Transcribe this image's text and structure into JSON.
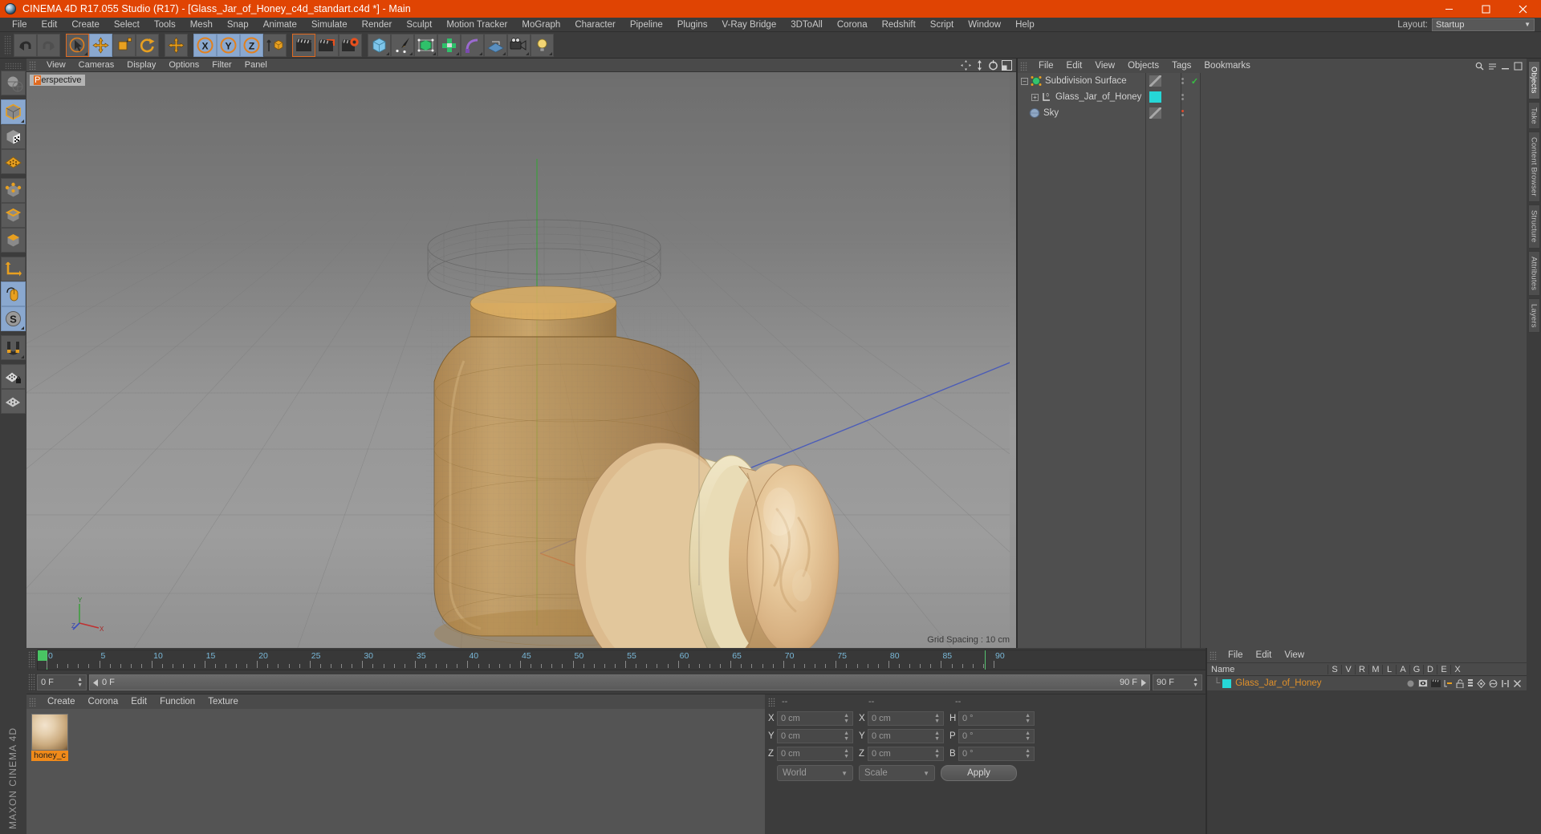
{
  "window": {
    "title": "CINEMA 4D R17.055 Studio (R17) - [Glass_Jar_of_Honey_c4d_standart.c4d *] - Main",
    "minimize": "minimize-icon",
    "maximize": "maximize-icon",
    "close": "close-icon",
    "accent_color": "#e04403"
  },
  "menubar": {
    "items": [
      "File",
      "Edit",
      "Create",
      "Select",
      "Tools",
      "Mesh",
      "Snap",
      "Animate",
      "Simulate",
      "Render",
      "Sculpt",
      "Motion Tracker",
      "MoGraph",
      "Character",
      "Pipeline",
      "Plugins",
      "V-Ray Bridge",
      "3DToAll",
      "Corona",
      "Redshift",
      "Script",
      "Window",
      "Help"
    ],
    "layout_label": "Layout:",
    "layout_value": "Startup"
  },
  "toolbar": {
    "groups": [
      {
        "name": "history",
        "buttons": [
          {
            "name": "undo-button",
            "icon": "undo-arrow-icon",
            "state": "normal"
          },
          {
            "name": "redo-button",
            "icon": "redo-arrow-icon",
            "state": "disabled"
          }
        ]
      },
      {
        "name": "transform",
        "buttons": [
          {
            "name": "live-selection-button",
            "icon": "cursor-circle-icon",
            "state": "highlight"
          },
          {
            "name": "move-button",
            "icon": "move-arrows-icon",
            "state": "active"
          },
          {
            "name": "scale-button",
            "icon": "scale-box-icon",
            "state": "normal"
          },
          {
            "name": "rotate-button",
            "icon": "rotate-circle-icon",
            "state": "normal"
          }
        ]
      },
      {
        "name": "axis",
        "buttons": [
          {
            "name": "world-object-axis-button",
            "icon": "move-arrows-icon",
            "state": "normal"
          }
        ]
      },
      {
        "name": "lock-axes",
        "buttons": [
          {
            "name": "lock-x-button",
            "icon": "x-axis-icon",
            "state": "active",
            "label": "X"
          },
          {
            "name": "lock-y-button",
            "icon": "y-axis-icon",
            "state": "active",
            "label": "Y"
          },
          {
            "name": "lock-z-button",
            "icon": "z-axis-icon",
            "state": "active",
            "label": "Z"
          },
          {
            "name": "coordinate-system-button",
            "icon": "world-coordinate-icon",
            "state": "normal"
          }
        ]
      },
      {
        "name": "render",
        "buttons": [
          {
            "name": "render-view-button",
            "icon": "clapper-icon",
            "state": "highlight"
          },
          {
            "name": "render-region-button",
            "icon": "clapper-region-icon",
            "state": "normal"
          },
          {
            "name": "render-settings-button",
            "icon": "clapper-gear-icon",
            "state": "normal"
          }
        ]
      },
      {
        "name": "create",
        "buttons": [
          {
            "name": "add-cube-button",
            "icon": "cube-icon",
            "state": "normal"
          },
          {
            "name": "add-spline-button",
            "icon": "pen-icon",
            "state": "normal"
          },
          {
            "name": "nurbs-button",
            "icon": "subdivision-cube-icon",
            "state": "normal"
          },
          {
            "name": "array-button",
            "icon": "array-icon",
            "state": "normal"
          },
          {
            "name": "deformer-button",
            "icon": "bend-deformer-icon",
            "state": "normal"
          },
          {
            "name": "scene-button",
            "icon": "floor-scene-icon",
            "state": "normal"
          },
          {
            "name": "camera-button",
            "icon": "camera-icon",
            "state": "normal"
          },
          {
            "name": "light-button",
            "icon": "light-bulb-icon",
            "state": "normal"
          }
        ]
      }
    ]
  },
  "left_palette": {
    "buttons": [
      {
        "name": "texture-axis-button",
        "icon": "globe-texture-icon",
        "state": "normal"
      },
      {
        "name": "model-mode-button",
        "icon": "model-cube-icon",
        "state": "active"
      },
      {
        "name": "texture-mode-button",
        "icon": "texture-cube-icon",
        "state": "normal"
      },
      {
        "name": "workplane-button",
        "icon": "grid-plane-icon",
        "state": "normal"
      },
      {
        "name": "points-mode-button",
        "icon": "points-cube-icon",
        "state": "normal"
      },
      {
        "name": "edges-mode-button",
        "icon": "edges-cube-icon",
        "state": "normal"
      },
      {
        "name": "polygons-mode-button",
        "icon": "polygons-cube-icon",
        "state": "normal"
      },
      {
        "name": "object-axis-button",
        "icon": "axis-corner-icon",
        "state": "normal"
      },
      {
        "name": "enable-axis-button",
        "icon": "mouse-icon",
        "state": "active"
      },
      {
        "name": "soft-selection-button",
        "icon": "s-circle-icon",
        "state": "active"
      },
      {
        "name": "snap-magnet-button",
        "icon": "magnet-icon",
        "state": "normal"
      },
      {
        "name": "lock-workplane-button",
        "icon": "grid-lock-icon",
        "state": "normal"
      },
      {
        "name": "workplane-mode-button",
        "icon": "grid-mode-icon",
        "state": "normal"
      }
    ]
  },
  "viewport": {
    "menu": [
      "View",
      "Cameras",
      "Display",
      "Options",
      "Filter",
      "Panel"
    ],
    "label_prefix": "P",
    "label_rest": "erspective",
    "grid_spacing": "Grid Spacing : 10 cm",
    "axis_labels": {
      "y": "Y",
      "z": "Z",
      "x": "X"
    },
    "nav_icons": [
      "pan-icon",
      "dolly-icon",
      "rotate-icon",
      "maximize-view-icon"
    ]
  },
  "object_manager": {
    "menu": [
      "File",
      "Edit",
      "View",
      "Objects",
      "Tags",
      "Bookmarks"
    ],
    "right_icons": [
      "search-icon",
      "options-icon",
      "minimize-icon",
      "maximize-icon"
    ],
    "objects": [
      {
        "name": "Subdivision Surface",
        "icon": "subdivision-surface-icon",
        "indent": 0,
        "expander": "-",
        "tag": "none",
        "dots": 2,
        "check": true
      },
      {
        "name": "Glass_Jar_of_Honey",
        "icon": "null-object-icon",
        "indent": 1,
        "expander": "+",
        "tag": "cyan",
        "dots": 2,
        "check": false
      },
      {
        "name": "Sky",
        "icon": "sky-icon",
        "indent": 0,
        "expander": "",
        "tag": "none",
        "dots": 2,
        "check": false,
        "red_dot": true
      }
    ]
  },
  "right_tabs": [
    {
      "label": "Objects",
      "selected": true
    },
    {
      "label": "Take"
    },
    {
      "label": "Content Browser"
    },
    {
      "label": "Structure"
    },
    {
      "label": "Attributes"
    },
    {
      "label": "Layers"
    }
  ],
  "timeline": {
    "ticks": [
      0,
      5,
      10,
      15,
      20,
      25,
      30,
      35,
      40,
      45,
      50,
      55,
      60,
      65,
      70,
      75,
      80,
      85,
      90
    ],
    "current_frame": "0 F",
    "end_field": "0 F",
    "playhead_frame": 0
  },
  "transport": {
    "start_field": "0 F",
    "range_start": "0 F",
    "range_end": "90 F",
    "end_field": "90 F",
    "buttons": [
      {
        "name": "go-to-start-button",
        "icon": "skip-start-icon",
        "state": "normal"
      },
      {
        "name": "loop-button",
        "icon": "loop-icon",
        "state": "normal"
      },
      {
        "name": "step-back-button",
        "icon": "step-back-icon",
        "state": "normal"
      },
      {
        "name": "play-button",
        "icon": "play-icon",
        "state": "normal"
      },
      {
        "name": "step-forward-button",
        "icon": "step-forward-icon",
        "state": "normal"
      },
      {
        "name": "go-to-end-button",
        "icon": "skip-end-icon",
        "state": "normal"
      },
      {
        "name": "record-active-button",
        "icon": "record-objects-icon",
        "state": "normal"
      },
      {
        "name": "autokey-button",
        "icon": "autokey-icon",
        "state": "normal"
      },
      {
        "name": "keyframe-selection-button",
        "icon": "keyframe-select-icon",
        "state": "normal"
      },
      {
        "name": "position-key-button",
        "icon": "position-key-icon",
        "state": "active"
      },
      {
        "name": "scale-key-button",
        "icon": "scale-key-icon",
        "state": "active"
      },
      {
        "name": "rotation-key-button",
        "icon": "rotation-key-icon",
        "state": "active"
      },
      {
        "name": "param-key-button",
        "icon": "param-key-icon",
        "state": "active"
      },
      {
        "name": "pla-key-button",
        "icon": "pla-key-icon",
        "state": "normal"
      },
      {
        "name": "timeline-button",
        "icon": "timeline-icon",
        "state": "active"
      }
    ]
  },
  "material_manager": {
    "menu": [
      "Create",
      "Corona",
      "Edit",
      "Function",
      "Texture"
    ],
    "materials": [
      {
        "name": "honey_c",
        "preview": "honey-sphere-preview",
        "selected": true
      }
    ]
  },
  "coordinates": {
    "headers": [
      "--",
      "--",
      "--"
    ],
    "rows": [
      {
        "label1": "X",
        "value1": "0 cm",
        "label2": "X",
        "value2": "0 cm",
        "label3": "H",
        "value3": "0 °"
      },
      {
        "label1": "Y",
        "value1": "0 cm",
        "label2": "Y",
        "value2": "0 cm",
        "label3": "P",
        "value3": "0 °"
      },
      {
        "label1": "Z",
        "value1": "0 cm",
        "label2": "Z",
        "value2": "0 cm",
        "label3": "B",
        "value3": "0 °"
      }
    ],
    "system": "World",
    "mode": "Scale",
    "apply": "Apply"
  },
  "attribute_panel": {
    "menu": [
      "File",
      "Edit",
      "View"
    ],
    "columns": [
      "Name",
      "S",
      "V",
      "R",
      "M",
      "L",
      "A",
      "G",
      "D",
      "E",
      "X"
    ],
    "rows": [
      {
        "name": "Glass_Jar_of_Honey",
        "color": "#26d7d7"
      }
    ]
  },
  "branding": {
    "line1": "MAXON",
    "line2": "CINEMA 4D"
  }
}
